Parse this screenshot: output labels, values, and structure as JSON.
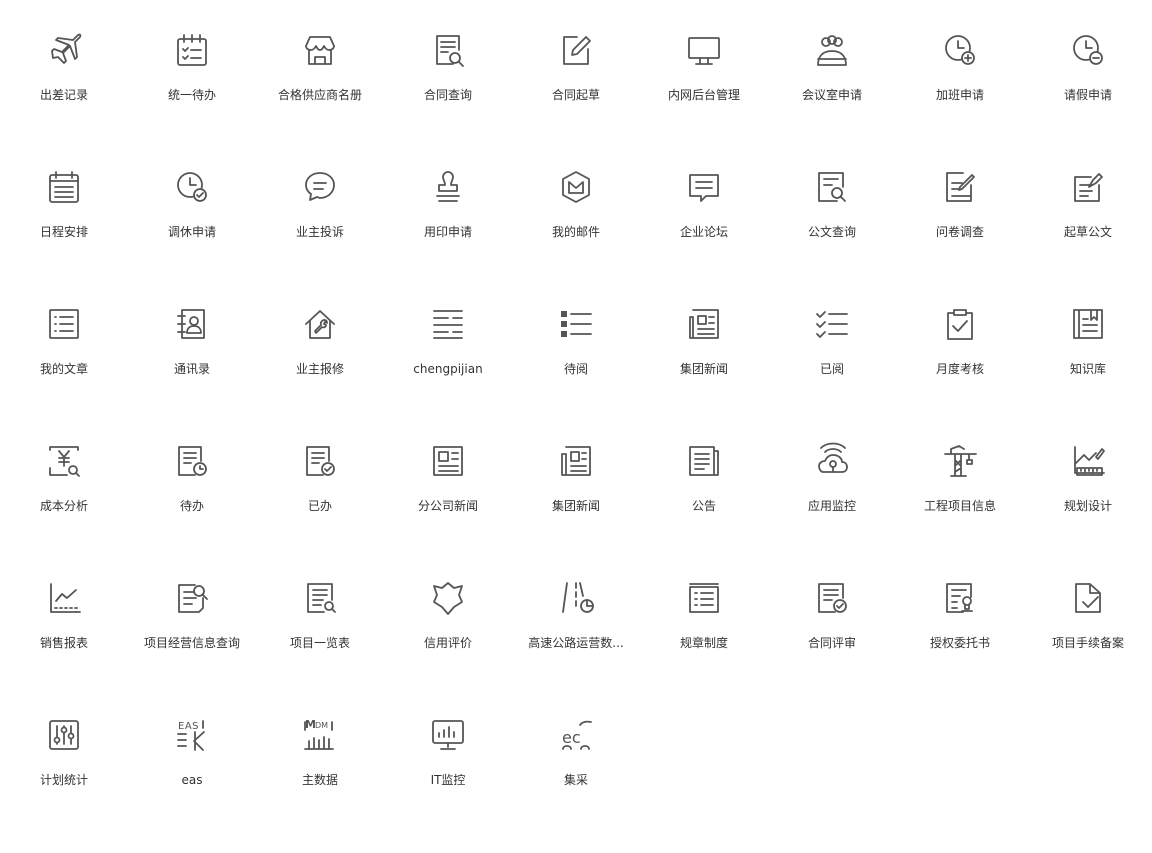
{
  "apps": [
    {
      "label": "出差记录",
      "icon": "airplane-icon"
    },
    {
      "label": "统一待办",
      "icon": "calendar-checklist-icon"
    },
    {
      "label": "合格供应商名册",
      "icon": "store-icon"
    },
    {
      "label": "合同查询",
      "icon": "contract-search-icon"
    },
    {
      "label": "合同起草",
      "icon": "edit-icon"
    },
    {
      "label": "内网后台管理",
      "icon": "monitor-icon"
    },
    {
      "label": "会议室申请",
      "icon": "meeting-group-icon"
    },
    {
      "label": "加班申请",
      "icon": "clock-plus-icon"
    },
    {
      "label": "请假申请",
      "icon": "clock-minus-icon"
    },
    {
      "label": "日程安排",
      "icon": "calendar-icon"
    },
    {
      "label": "调休申请",
      "icon": "clock-check-icon"
    },
    {
      "label": "业主投诉",
      "icon": "chat-bubble-icon"
    },
    {
      "label": "用印申请",
      "icon": "stamp-icon"
    },
    {
      "label": "我的邮件",
      "icon": "mail-hexagon-icon"
    },
    {
      "label": "企业论坛",
      "icon": "forum-icon"
    },
    {
      "label": "公文查询",
      "icon": "document-search-icon"
    },
    {
      "label": "问卷调查",
      "icon": "survey-icon"
    },
    {
      "label": "起草公文",
      "icon": "draft-document-icon"
    },
    {
      "label": "我的文章",
      "icon": "article-list-icon"
    },
    {
      "label": "通讯录",
      "icon": "contacts-icon"
    },
    {
      "label": "业主报修",
      "icon": "repair-house-icon"
    },
    {
      "label": "chengpijian",
      "icon": "approval-icon"
    },
    {
      "label": "待阅",
      "icon": "bullet-list-icon"
    },
    {
      "label": "集团新闻",
      "icon": "newspaper-icon"
    },
    {
      "label": "已阅",
      "icon": "check-list-icon"
    },
    {
      "label": "月度考核",
      "icon": "clipboard-check-icon"
    },
    {
      "label": "知识库",
      "icon": "book-icon"
    },
    {
      "label": "成本分析",
      "icon": "cost-analysis-icon"
    },
    {
      "label": "待办",
      "icon": "document-clock-icon"
    },
    {
      "label": "已办",
      "icon": "document-check-icon"
    },
    {
      "label": "分公司新闻",
      "icon": "branch-news-icon"
    },
    {
      "label": "集团新闻",
      "icon": "group-news-icon"
    },
    {
      "label": "公告",
      "icon": "notice-icon"
    },
    {
      "label": "应用监控",
      "icon": "cloud-monitor-icon"
    },
    {
      "label": "工程项目信息",
      "icon": "crane-icon"
    },
    {
      "label": "规划设计",
      "icon": "design-ruler-icon"
    },
    {
      "label": "销售报表",
      "icon": "sales-chart-icon"
    },
    {
      "label": "项目经营信息查询",
      "icon": "project-search-icon"
    },
    {
      "label": "项目一览表",
      "icon": "project-list-icon"
    },
    {
      "label": "信用评价",
      "icon": "credit-shield-icon"
    },
    {
      "label": "高速公路运营数...",
      "icon": "highway-icon"
    },
    {
      "label": "规章制度",
      "icon": "regulation-icon"
    },
    {
      "label": "合同评审",
      "icon": "contract-review-icon"
    },
    {
      "label": "授权委托书",
      "icon": "authorization-icon"
    },
    {
      "label": "项目手续备案",
      "icon": "file-check-icon"
    },
    {
      "label": "计划统计",
      "icon": "sliders-icon"
    },
    {
      "label": "eas",
      "icon": "eas-logo-icon"
    },
    {
      "label": "主数据",
      "icon": "mdm-icon"
    },
    {
      "label": "IT监控",
      "icon": "it-monitor-icon"
    },
    {
      "label": "集采",
      "icon": "ec-logo-icon"
    }
  ]
}
